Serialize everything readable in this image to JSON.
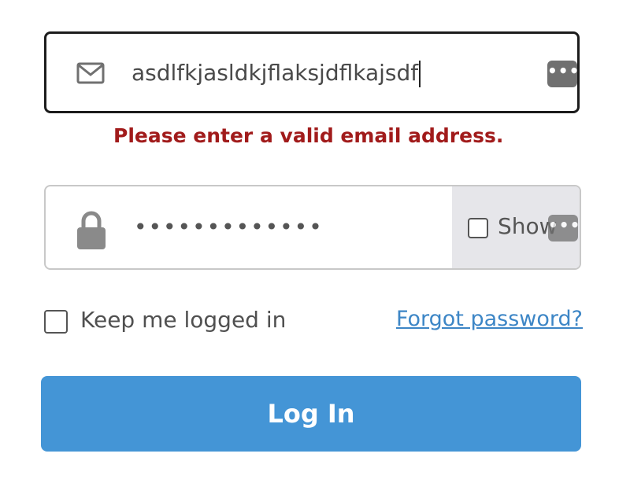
{
  "email": {
    "value": "asdlfkjasldkjflaksjdflkajsdf",
    "icon": "envelope-icon",
    "password_manager_icon": "password-manager-icon",
    "password_manager_glyph": "•••"
  },
  "error": {
    "message": "Please enter a valid email address.",
    "color": "#a11b1b"
  },
  "password": {
    "masked_value": "•••••••••••••",
    "icon": "lock-icon",
    "show_label": "Show",
    "show_checked": false,
    "password_manager_glyph": "•••"
  },
  "remember": {
    "label": "Keep me logged in",
    "checked": false
  },
  "forgot_link": {
    "label": "Forgot password?",
    "color": "#3d86c6"
  },
  "login_button": {
    "label": "Log In",
    "color": "#4495d6"
  }
}
